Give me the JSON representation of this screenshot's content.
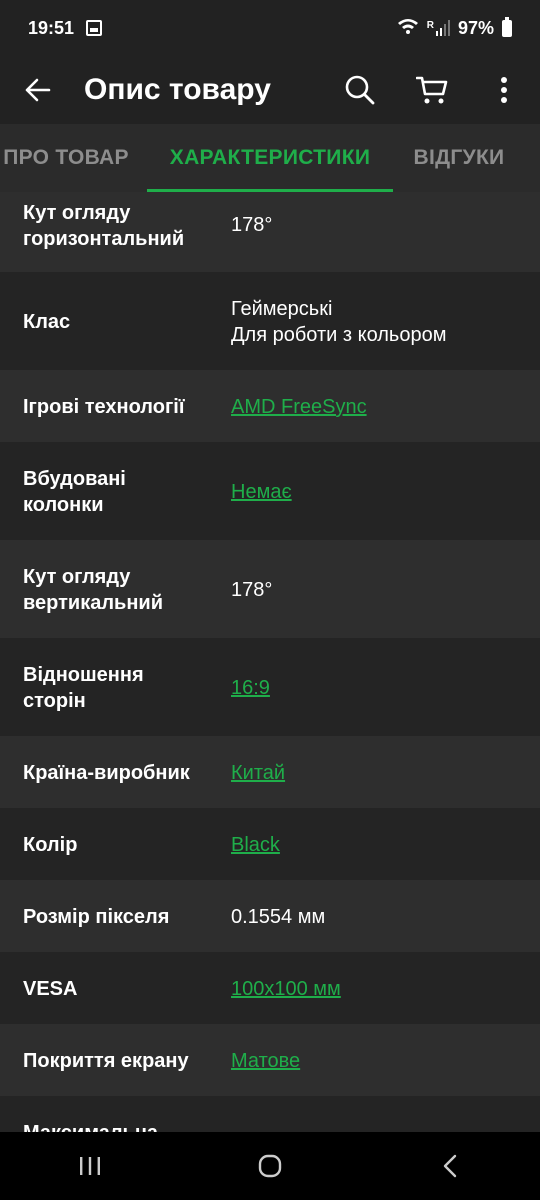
{
  "status_bar": {
    "time": "19:51",
    "battery": "97%",
    "signal_letters": "R",
    "icons": [
      "image-icon",
      "wifi-icon",
      "signal-icon",
      "battery-icon"
    ]
  },
  "app_bar": {
    "title": "Опис товару",
    "icons": [
      "back-arrow-icon",
      "search-icon",
      "cart-icon",
      "more-vert-icon"
    ]
  },
  "tabs": [
    {
      "label": "ПРО ТОВАР",
      "active": false
    },
    {
      "label": "ХАРАКТЕРИСТИКИ",
      "active": true
    },
    {
      "label": "ВІДГУКИ",
      "active": false
    }
  ],
  "accent_color": "#1fae4a",
  "specs": [
    {
      "label": "Кут огляду\nгоризонтальний",
      "value": "178°",
      "link": false
    },
    {
      "label": "Клас",
      "value": "Геймерські\nДля роботи з кольором",
      "link": false
    },
    {
      "label": "Ігрові технології",
      "value": "AMD FreeSync",
      "link": true
    },
    {
      "label": "Вбудовані\nколонки",
      "value": "Немає",
      "link": true
    },
    {
      "label": "Кут огляду\nвертикальний",
      "value": "178°",
      "link": false
    },
    {
      "label": "Відношення\nсторін",
      "value": "16:9",
      "link": true
    },
    {
      "label": "Країна-виробник",
      "value": "Китай",
      "link": true
    },
    {
      "label": "Колір",
      "value": "Black",
      "link": true
    },
    {
      "label": "Розмір пікселя",
      "value": "0.1554 мм",
      "link": false
    },
    {
      "label": "VESA",
      "value": "100x100 мм",
      "link": true
    },
    {
      "label": "Покриття екрану",
      "value": "Матове",
      "link": true
    },
    {
      "label": "Максимальна",
      "value": "",
      "link": false
    }
  ],
  "nav_bar": {
    "icons": [
      "recent-apps-icon",
      "home-icon",
      "back-icon"
    ]
  }
}
